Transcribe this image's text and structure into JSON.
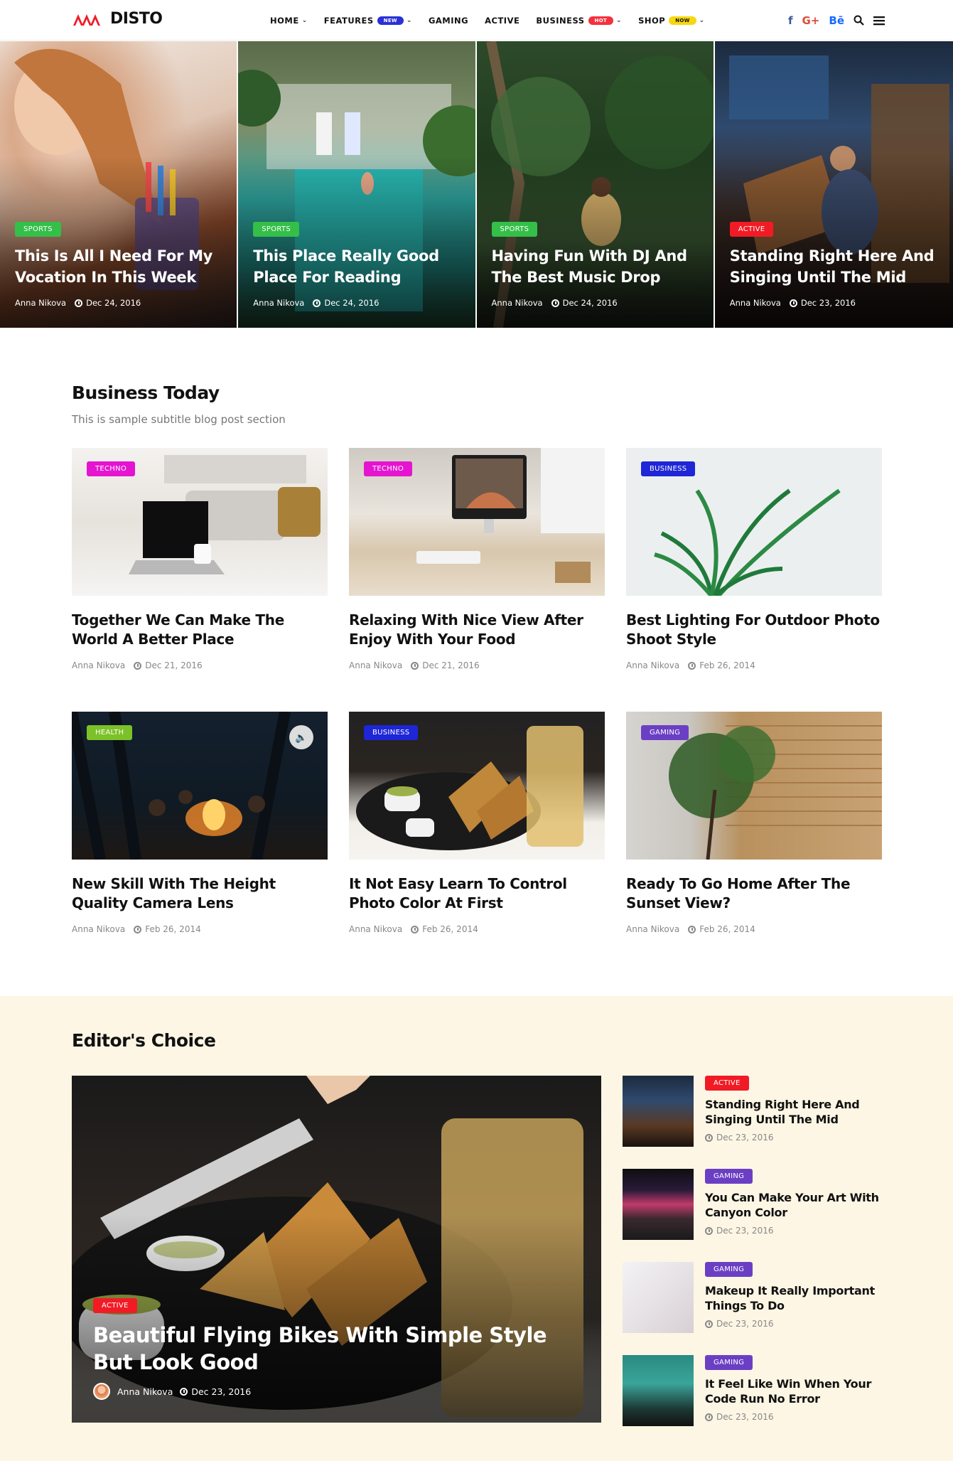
{
  "header": {
    "logo_text": "DISTO",
    "nav": [
      {
        "label": "HOME",
        "dropdown": true
      },
      {
        "label": "FEATURES",
        "badge": "NEW",
        "badge_color": "#2b31d6",
        "dropdown": true
      },
      {
        "label": "GAMING"
      },
      {
        "label": "ACTIVE"
      },
      {
        "label": "BUSINESS",
        "badge": "HOT",
        "badge_color": "#f4313f",
        "dropdown": true
      },
      {
        "label": "SHOP",
        "badge": "NOW",
        "badge_color": "#f7d80f",
        "dropdown": true
      }
    ],
    "social": {
      "facebook": "f",
      "google_plus": "G+",
      "behance": "Bē"
    },
    "icons": [
      "search-icon",
      "menu-icon"
    ]
  },
  "hero": [
    {
      "category": "SPORTS",
      "cat_color": "#34bf49",
      "title": "This Is All I Need For My Vocation In This Week",
      "author": "Anna Nikova",
      "date": "Dec 24, 2016"
    },
    {
      "category": "SPORTS",
      "cat_color": "#34bf49",
      "title": "This Place Really Good Place For Reading",
      "author": "Anna Nikova",
      "date": "Dec 24, 2016"
    },
    {
      "category": "SPORTS",
      "cat_color": "#34bf49",
      "title": "Having Fun With DJ And The Best Music Drop",
      "author": "Anna Nikova",
      "date": "Dec 24, 2016"
    },
    {
      "category": "ACTIVE",
      "cat_color": "#f11b25",
      "title": "Standing Right Here And Singing Until The Mid",
      "author": "Anna Nikova",
      "date": "Dec 23, 2016"
    }
  ],
  "business": {
    "title": "Business Today",
    "subtitle": "This is sample subtitle blog post section",
    "posts": [
      {
        "category": "TECHNO",
        "cat_color": "#e514d1",
        "title": "Together We Can Make The World A Better Place",
        "author": "Anna Nikova",
        "date": "Dec 21, 2016"
      },
      {
        "category": "TECHNO",
        "cat_color": "#e514d1",
        "title": "Relaxing With Nice View After Enjoy With Your Food",
        "author": "Anna Nikova",
        "date": "Dec 21, 2016"
      },
      {
        "category": "BUSINESS",
        "cat_color": "#1e26d6",
        "title": "Best Lighting For Outdoor Photo Shoot Style",
        "author": "Anna Nikova",
        "date": "Feb 26, 2014"
      },
      {
        "category": "HEALTH",
        "cat_color": "#7bc128",
        "title": "New Skill With The Height Quality Camera Lens",
        "author": "Anna Nikova",
        "date": "Feb 26, 2014"
      },
      {
        "category": "BUSINESS",
        "cat_color": "#1e26d6",
        "title": "It Not Easy Learn To Control Photo Color At First",
        "author": "Anna Nikova",
        "date": "Feb 26, 2014"
      },
      {
        "category": "GAMING",
        "cat_color": "#6b3fc4",
        "title": "Ready To Go Home After The Sunset View?",
        "author": "Anna Nikova",
        "date": "Feb 26, 2014"
      }
    ]
  },
  "editors": {
    "title": "Editor's Choice",
    "featured": {
      "category": "ACTIVE",
      "cat_color": "#f11b25",
      "title": "Beautiful Flying Bikes With Simple Style But Look Good",
      "author": "Anna Nikova",
      "date": "Dec 23, 2016"
    },
    "list": [
      {
        "category": "ACTIVE",
        "cat_color": "#f11b25",
        "title": "Standing Right Here And Singing Until The Mid",
        "date": "Dec 23, 2016"
      },
      {
        "category": "GAMING",
        "cat_color": "#6b3fc4",
        "title": "You Can Make Your Art With Canyon Color",
        "date": "Dec 23, 2016"
      },
      {
        "category": "GAMING",
        "cat_color": "#6b3fc4",
        "title": "Makeup It Really Important Things To Do",
        "date": "Dec 23, 2016"
      },
      {
        "category": "GAMING",
        "cat_color": "#6b3fc4",
        "title": "It Feel Like Win When Your Code Run No Error",
        "date": "Dec 23, 2016"
      }
    ]
  }
}
